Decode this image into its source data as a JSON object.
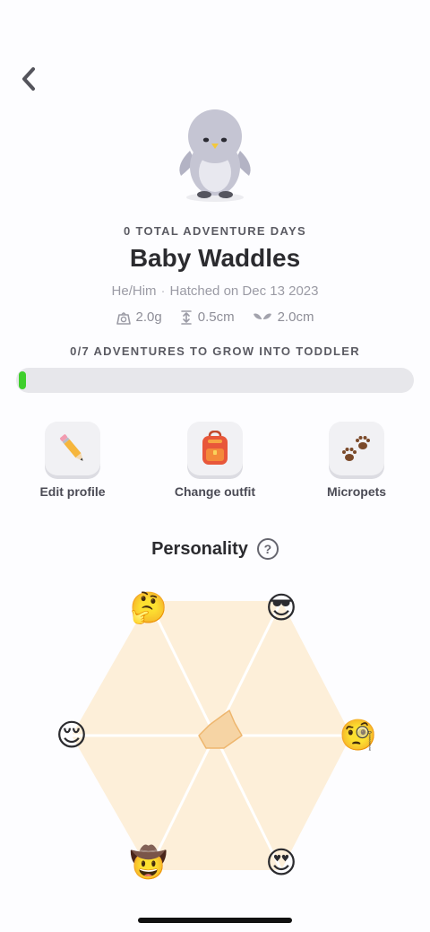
{
  "header": {
    "back_icon": "chevron-left-icon"
  },
  "pet": {
    "adventure_days_label": "0 TOTAL ADVENTURE DAYS",
    "name": "Baby Waddles",
    "pronouns": "He/Him",
    "separator": "·",
    "hatched": "Hatched on Dec 13 2023",
    "stats": {
      "weight": "2.0g",
      "height": "0.5cm",
      "wingspan": "2.0cm"
    }
  },
  "growth": {
    "label": "0/7 ADVENTURES TO GROW INTO TODDLER",
    "progress_fraction": 0,
    "fill_color": "#3fcf2c"
  },
  "actions": [
    {
      "label": "Edit profile",
      "icon": "pencil-icon"
    },
    {
      "label": "Change outfit",
      "icon": "backpack-icon"
    },
    {
      "label": "Micropets",
      "icon": "paw-prints-icon"
    }
  ],
  "personality": {
    "title": "Personality",
    "help_glyph": "?",
    "hexagon_fill": "#fdefd9",
    "shape_fill": "#f6d4a4",
    "traits": [
      {
        "icon": "thinking-face-icon",
        "glyph": "🤔"
      },
      {
        "icon": "sunglasses-face-icon",
        "glyph": "😎"
      },
      {
        "icon": "relieved-face-icon",
        "glyph": "😌"
      },
      {
        "icon": "monocle-face-icon",
        "glyph": "🧐"
      },
      {
        "icon": "cowboy-face-icon",
        "glyph": "🤠"
      },
      {
        "icon": "heart-eyes-face-icon",
        "glyph": "😍"
      }
    ]
  }
}
